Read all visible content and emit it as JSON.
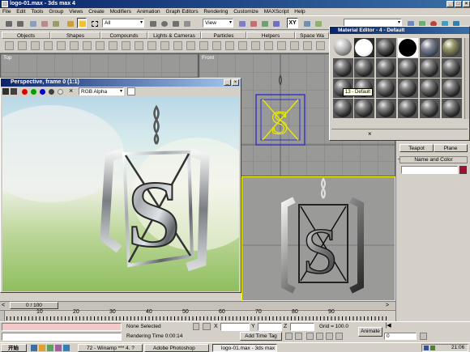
{
  "window": {
    "title": "logo-01.max - 3ds max 4"
  },
  "menubar": [
    "File",
    "Edit",
    "Tools",
    "Group",
    "Views",
    "Create",
    "Modifiers",
    "Animation",
    "Graph Editors",
    "Rendering",
    "Customize",
    "MAXScript",
    "Help"
  ],
  "toolbar": {
    "selection_filter": "All",
    "coord_system": "View",
    "xy_label": "XY"
  },
  "tabs": [
    "Objects",
    "Shapes",
    "Compounds",
    "Lights & Cameras",
    "Particles",
    "Helpers",
    "Space Wa"
  ],
  "viewports": {
    "top": "Top",
    "front": "Front"
  },
  "material_editor": {
    "title": "Material Editor - 4 - Default",
    "tooltip": "13 - Default"
  },
  "frame_window": {
    "title": "Perspective, frame 0 (1:1)",
    "channel": "RGB Alpha"
  },
  "command_panel": {
    "teapot": "Teapot",
    "plane": "Plane",
    "rollout": "Name and Color"
  },
  "timeline": {
    "position": "0 / 100",
    "ticks": [
      "10",
      "20",
      "30",
      "40",
      "50",
      "60",
      "70",
      "80",
      "90"
    ]
  },
  "status": {
    "selection": "None Selected",
    "rendering_time": "Rendering Time  0:00:14",
    "x_label": "X",
    "y_label": "Y",
    "z_label": "Z",
    "grid": "Grid = 100.0",
    "add_time_tag": "Add Time Tag",
    "animate": "Animate",
    "frame": "0"
  },
  "taskbar": {
    "start": "开始",
    "tasks": [
      "72 - Winamp *** 4. ?",
      "Adobe Photoshop",
      "logo-01.max - 3ds max 4"
    ],
    "clock": "21:06"
  },
  "colors": {
    "title_active": "#0a246a",
    "title_gradient": "#3a6ea5",
    "selection_yellow": "#ffff00",
    "swatch": "#a01030"
  }
}
